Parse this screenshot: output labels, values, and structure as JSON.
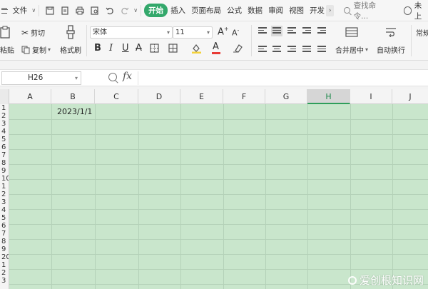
{
  "menubar": {
    "file": "文件",
    "tabs": [
      "开始",
      "插入",
      "页面布局",
      "公式",
      "数据",
      "审阅",
      "视图",
      "开发"
    ],
    "search": "查找命令...",
    "cloud": "未上"
  },
  "ribbon": {
    "paste": "粘贴",
    "cut": "剪切",
    "copy": "复制",
    "format_painter": "格式刷",
    "font": "宋体",
    "size": "11",
    "merge_center": "合并居中",
    "wrap_text": "自动换行",
    "number_format": "常规"
  },
  "formula_bar": {
    "name_box": "H26",
    "fx": "fx",
    "content": ""
  },
  "sheet": {
    "columns": [
      "A",
      "B",
      "C",
      "D",
      "E",
      "F",
      "G",
      "H",
      "I",
      "J"
    ],
    "selected_column": "H",
    "row_labels": [
      "1",
      "2",
      "3",
      "4",
      "5",
      "6",
      "7",
      "8",
      "9",
      "10",
      "1",
      "2",
      "3",
      "4",
      "5",
      "6",
      "7",
      "8",
      "9",
      "20",
      "1",
      "2",
      "3",
      "4"
    ],
    "cells": {
      "B1": "2023/1/1"
    }
  },
  "watermark": "爱创根知识网",
  "colors": {
    "accent": "#33a86b",
    "eye_protection_bg": "#c9e6cc"
  }
}
